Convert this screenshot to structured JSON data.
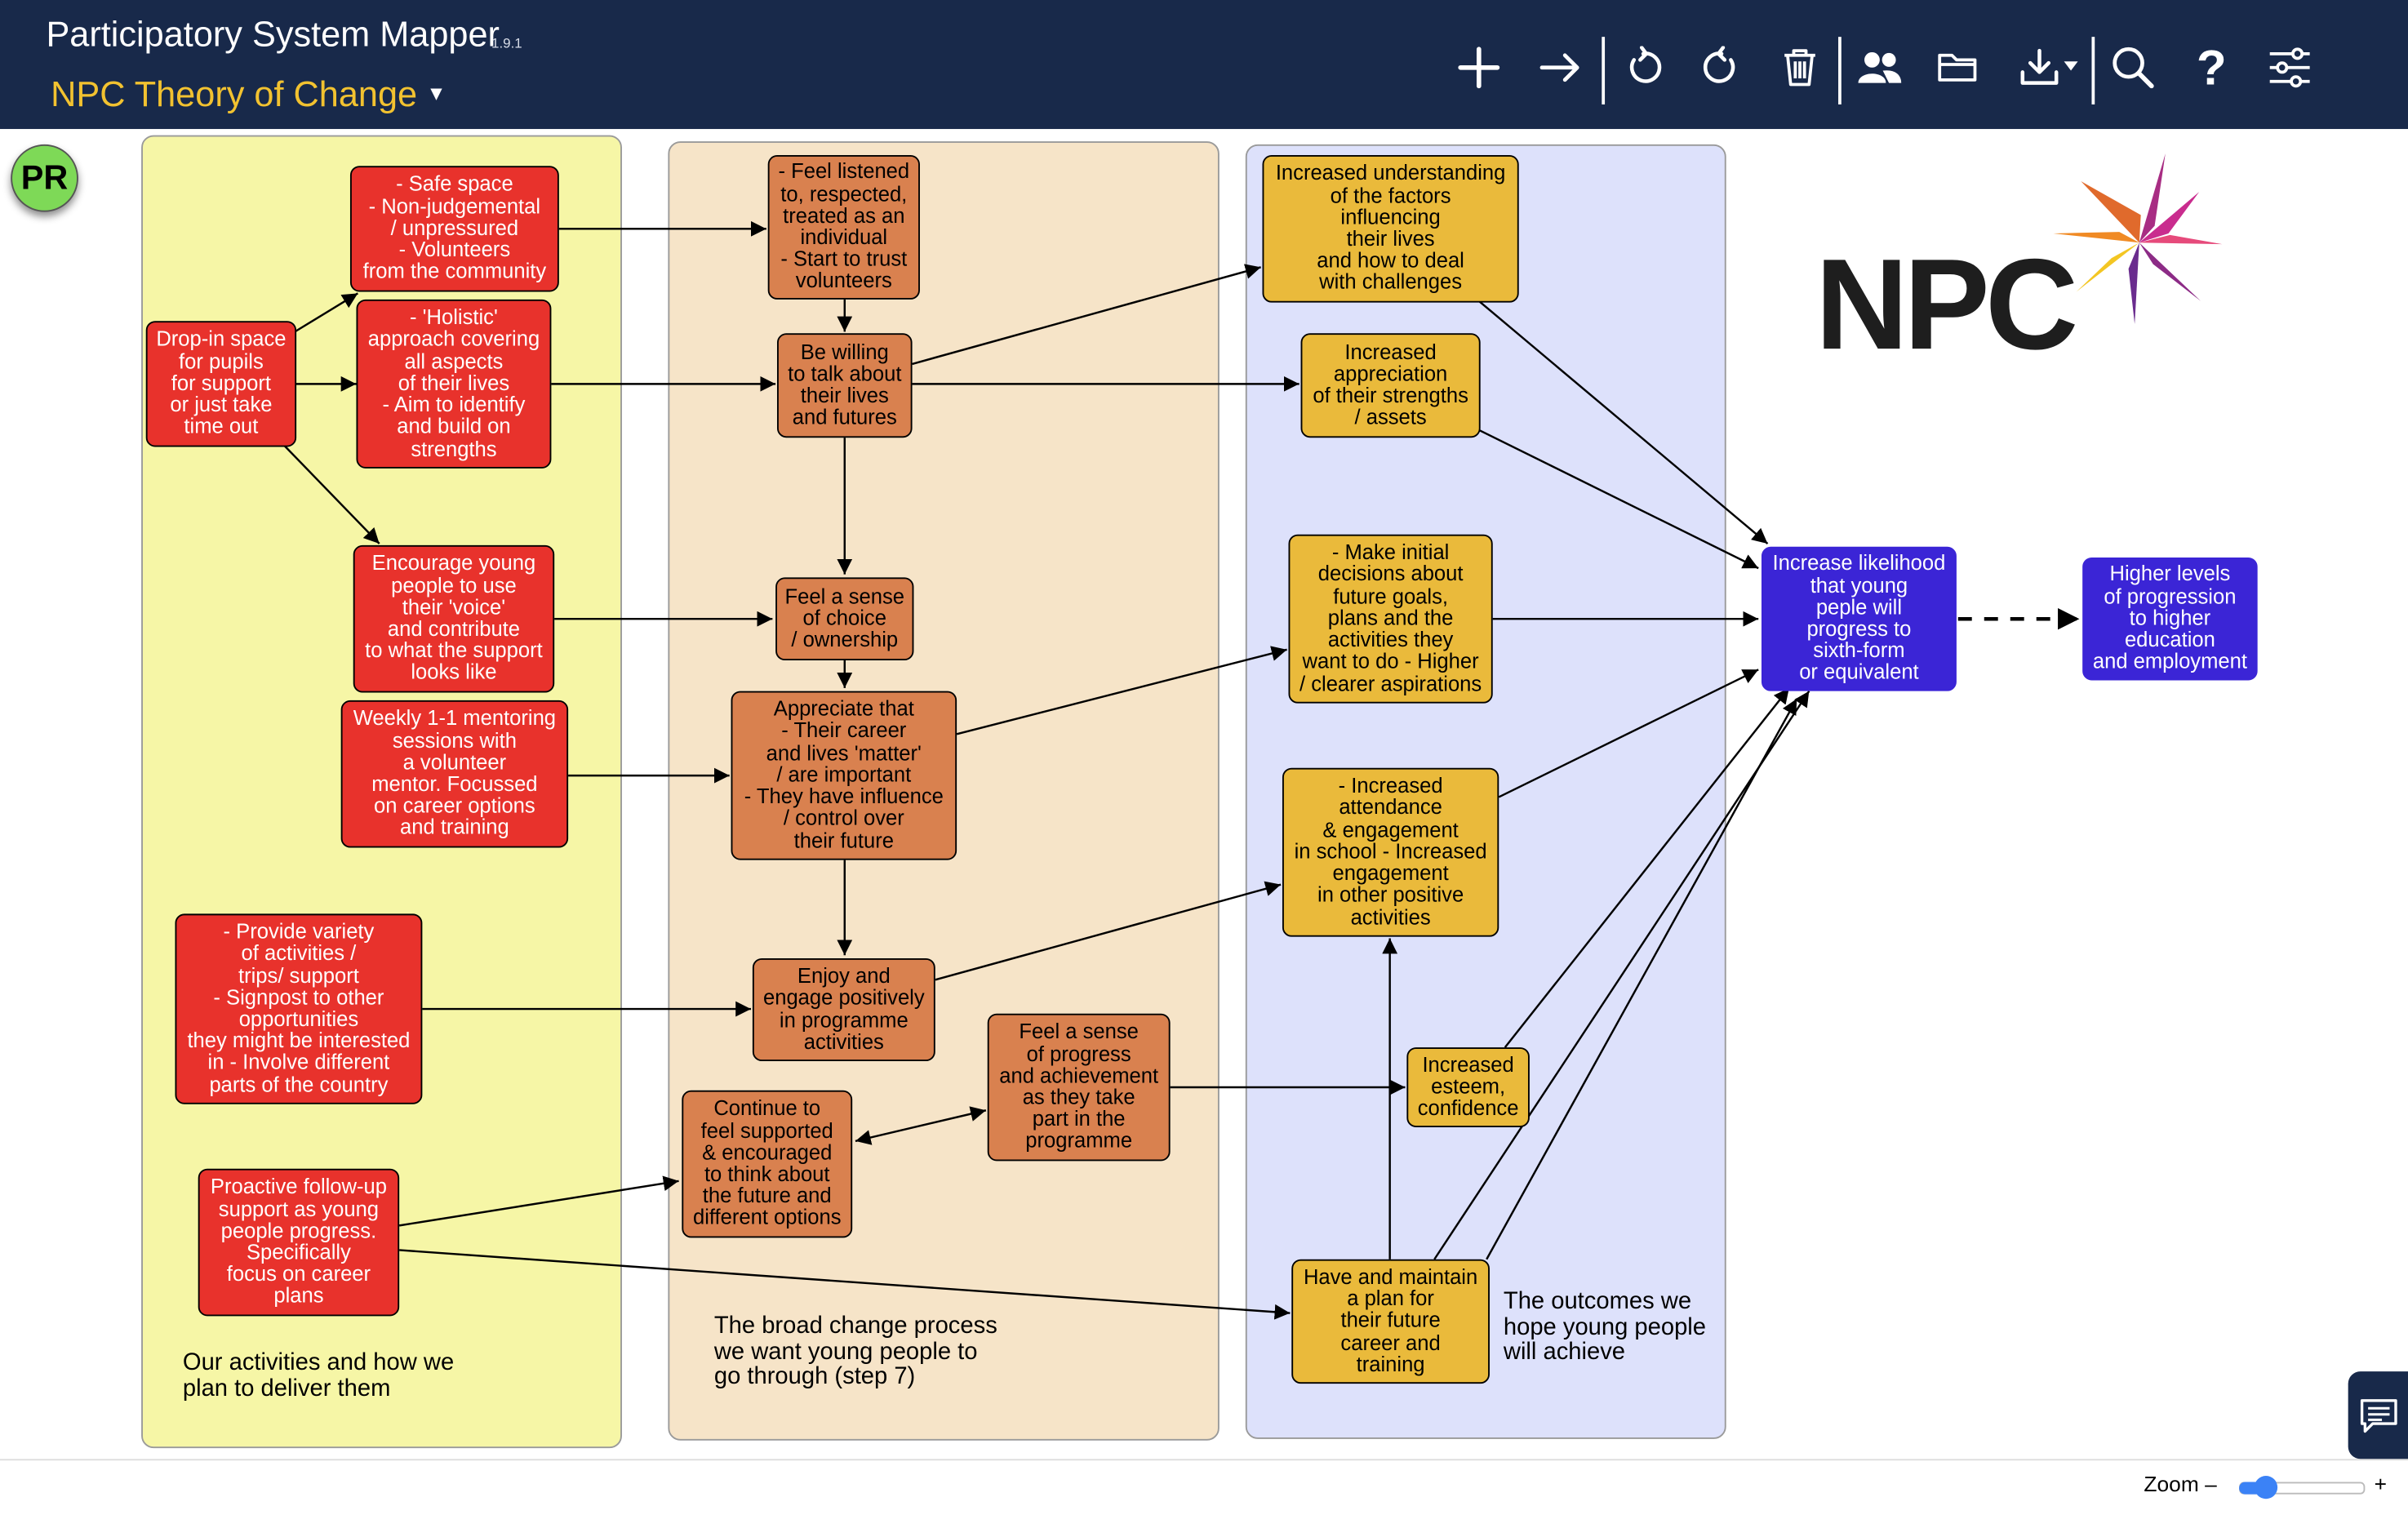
{
  "app": {
    "title": "Participatory System Mapper",
    "version": "1.9.1",
    "map_title": "NPC Theory of Change",
    "avatar_initials": "PR",
    "logo_text": "NPC"
  },
  "toolbar": {
    "icons": [
      "add-node-icon",
      "add-link-icon",
      "undo-icon",
      "redo-icon",
      "delete-icon",
      "share-users-icon",
      "open-folder-icon",
      "download-icon",
      "search-icon",
      "help-icon",
      "settings-sliders-icon"
    ],
    "help_glyph": "?"
  },
  "colors": {
    "header": "#18294a",
    "activity": "#e8322c",
    "change": "#d9814f",
    "outcome": "#eaba3b",
    "goal": "#3b25d6",
    "lane_yellow": "#f6f6a6",
    "lane_peach": "#f6e4c8",
    "lane_lavender": "#dde1fb"
  },
  "lanes": [
    "Our activities and how we\nplan to deliver them",
    "The broad change process\nwe want young people to\ngo through (step 7)",
    "The outcomes we\nhope young people\nwill achieve"
  ],
  "nodes": {
    "a1": "Drop-in space\nfor pupils\nfor support\nor just take\ntime out",
    "a2": "- Safe space\n- Non-judgemental\n/ unpressured\n- Volunteers\nfrom the community",
    "a3": "- 'Holistic'\napproach covering\nall aspects\nof their lives\n- Aim to identify\nand build on\nstrengths",
    "a4": "Encourage young\npeople to use\ntheir 'voice'\nand contribute\nto what the support\nlooks like",
    "a5": "Weekly 1-1 mentoring\nsessions with\na volunteer\nmentor. Focussed\non career options\nand training",
    "a6": "- Provide variety\nof activities /\ntrips/ support\n- Signpost to other\nopportunities\nthey might be interested\nin - Involve different\nparts of the country",
    "a7": "Proactive follow-up\nsupport as young\npeople progress.\nSpecifically\nfocus on career\nplans",
    "c1": "- Feel listened\nto, respected,\ntreated as an\nindividual\n- Start to trust\nvolunteers",
    "c2": "Be willing\nto talk about\ntheir lives\nand futures",
    "c3": "Feel a sense\nof choice\n/ ownership",
    "c4": "Appreciate that\n- Their career\nand lives 'matter'\n/ are important\n- They have influence\n/ control over\ntheir future",
    "c5": "Enjoy and\nengage positively\nin programme\nactivities",
    "c6": "Continue to\nfeel supported\n& encouraged\nto think about\nthe future and\ndifferent options",
    "c7": "Feel a sense\nof progress\nand achievement\nas they take\npart in the\nprogramme",
    "o1": "Increased understanding\nof the factors\ninfluencing\ntheir lives\nand how to deal\nwith challenges",
    "o2": "Increased\nappreciation\nof their strengths\n/ assets",
    "o3": "- Make initial\ndecisions about\nfuture goals,\nplans and the\nactivities they\nwant to do - Higher\n/ clearer aspirations",
    "o4": "- Increased\nattendance\n& engagement\nin school - Increased\nengagement\nin other positive\nactivities",
    "o5": "Increased\nesteem,\nconfidence",
    "o6": "Have and maintain\na plan for\ntheir future\ncareer and\ntraining",
    "g1": "Increase likelihood\nthat young\npeple will\nprogress to\nsixth-form\nor equivalent",
    "g2": "Higher levels\nof progression\nto higher\neducation\nand employment"
  },
  "zoom": {
    "label": "Zoom –",
    "plus": "+",
    "level": 0.2
  }
}
